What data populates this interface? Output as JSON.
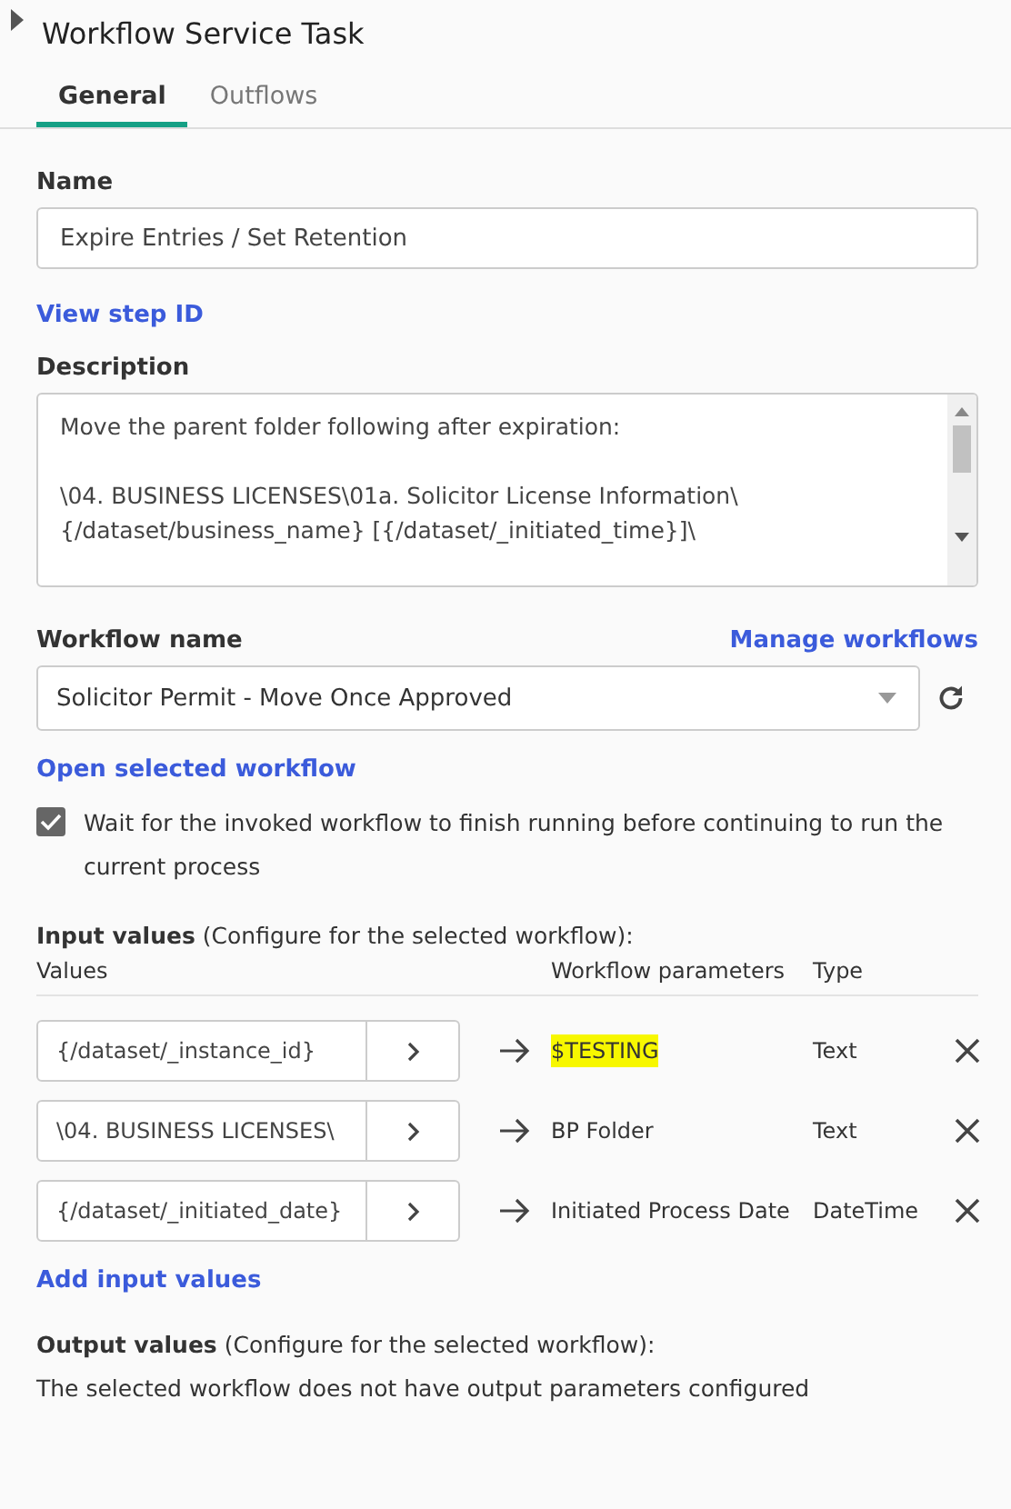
{
  "panel": {
    "title": "Workflow Service Task",
    "collapse_toggle": {
      "expanded": false
    }
  },
  "tabs": [
    {
      "label": "General",
      "selected": true
    },
    {
      "label": "Outflows",
      "selected": false
    }
  ],
  "name": {
    "label": "Name",
    "value": "Expire Entries / Set Retention"
  },
  "view_step_id": "View step ID",
  "description": {
    "label": "Description",
    "paragraphs": [
      [
        "Move the parent folder following after expiration:"
      ],
      [
        "\\04. BUSINESS LICENSES\\01a. Solicitor License Information\\",
        "{/dataset/business_name} [{/dataset/_initiated_time}]\\"
      ]
    ]
  },
  "workflow": {
    "label": "Workflow name",
    "manage_link": "Manage workflows",
    "value": "Solicitor Permit - Move Once Approved",
    "open_link": "Open selected workflow"
  },
  "wait_option": {
    "label": "Wait for the invoked workflow to finish running before continuing to run the current process",
    "checked": true
  },
  "input_values": {
    "heading": "**Input values** (Configure for the selected workflow):",
    "columns": [
      "Values",
      "Workflow parameters",
      "Type"
    ],
    "rows": [
      {
        "value": "{/dataset/_instance_id}",
        "parameter": "$TESTING",
        "highlighted": true,
        "type": "Text"
      },
      {
        "value": "\\04. BUSINESS LICENSES\\",
        "parameter": "BP Folder",
        "highlighted": false,
        "type": "Text"
      },
      {
        "value": "{/dataset/_initiated_date}",
        "parameter": "Initiated Process Date",
        "highlighted": false,
        "type": "DateTime"
      }
    ],
    "add_link": "Add input values"
  },
  "output_values": {
    "heading": "**Output values** (Configure for the selected workflow):",
    "message": "The selected workflow does not have output parameters configured"
  }
}
